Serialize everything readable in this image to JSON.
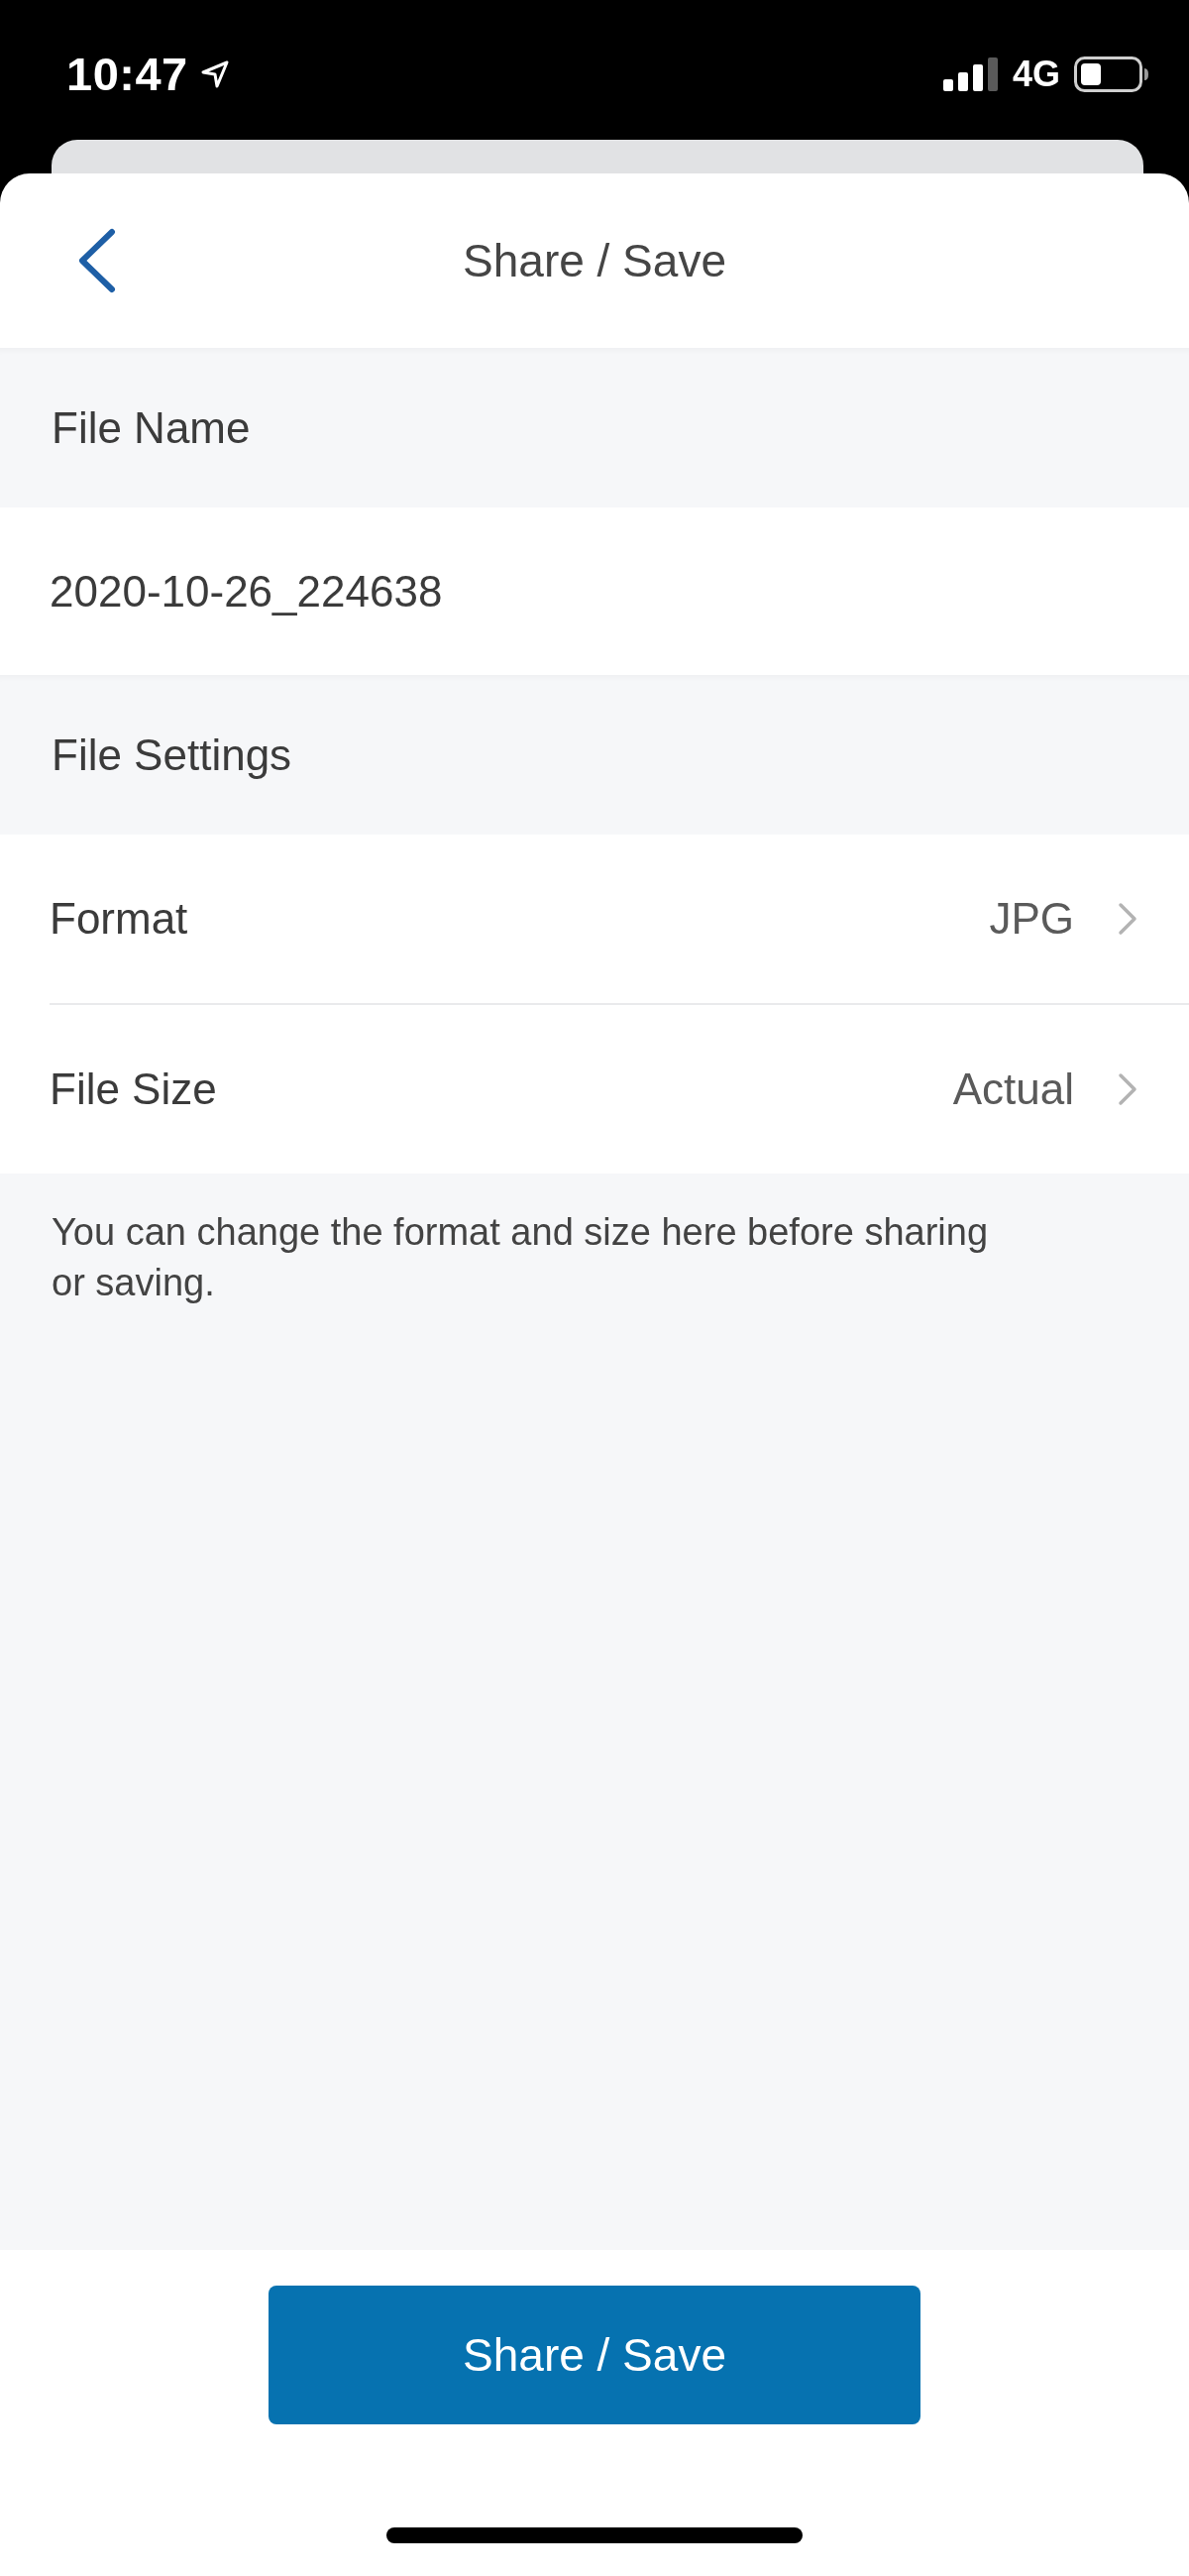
{
  "status_bar": {
    "time": "10:47",
    "network": "4G"
  },
  "nav_bar": {
    "title": "Share / Save"
  },
  "sections": [
    {
      "title": "File Name",
      "rows": [
        {
          "kind": "field",
          "value": "2020-10-26_224638"
        }
      ]
    },
    {
      "title": "File Settings",
      "rows": [
        {
          "kind": "option",
          "label": "Format",
          "value": "JPG"
        },
        {
          "kind": "option",
          "label": "File Size",
          "value": "Actual"
        }
      ]
    }
  ],
  "note": "You can change the format and size here before sharing or saving.",
  "primary_button": {
    "label": "Share / Save"
  }
}
